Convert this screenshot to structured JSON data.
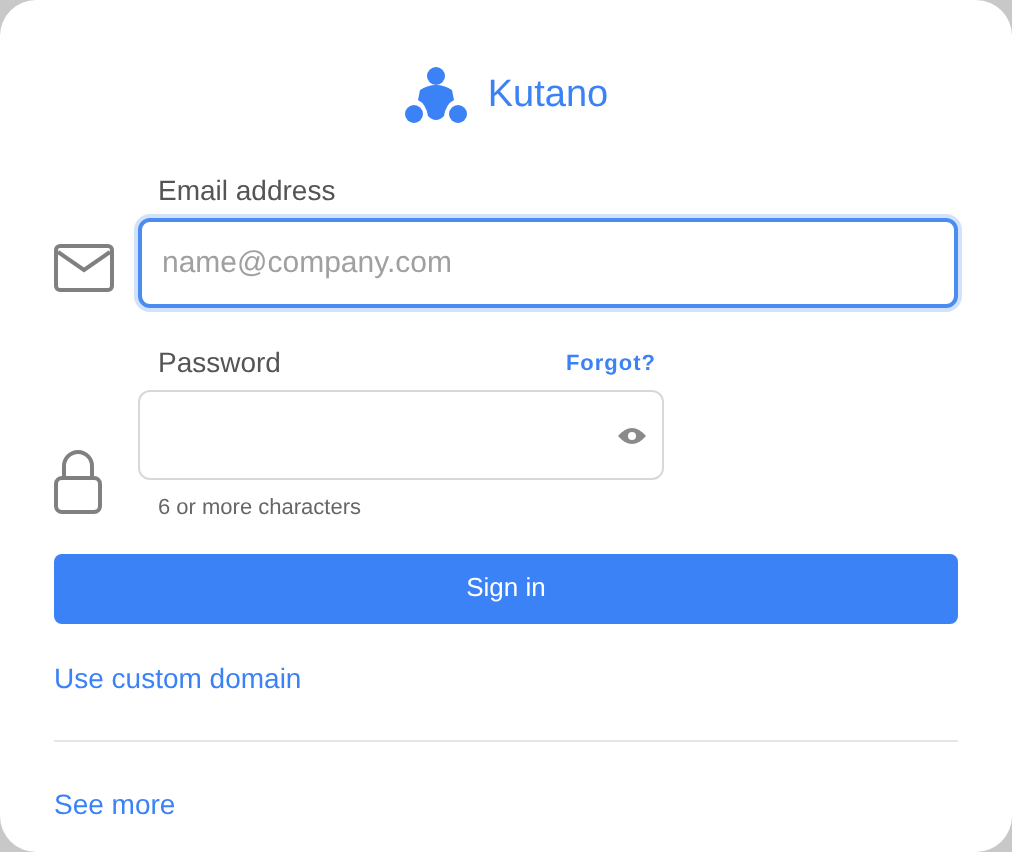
{
  "brand": {
    "name": "Kutano"
  },
  "email": {
    "label": "Email address",
    "placeholder": "name@company.com",
    "focused": true
  },
  "password": {
    "label": "Password",
    "forgot_link": "Forgot?",
    "hint": "6 or more characters",
    "focused": false
  },
  "sign_in_button": "Sign in",
  "custom_domain_link": "Use custom domain",
  "see_more_link": "See more"
}
